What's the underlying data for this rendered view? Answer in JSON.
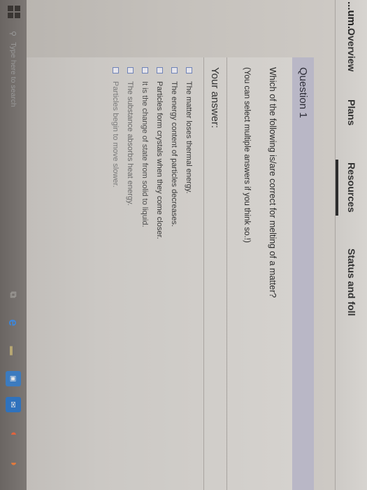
{
  "nav": {
    "partial_label": "...um...",
    "tabs": [
      {
        "label": "Overview"
      },
      {
        "label": "Plans"
      },
      {
        "label": "Resources"
      },
      {
        "label": "Status and foll"
      }
    ]
  },
  "question": {
    "header": "Question 1",
    "text": "Which of the following is/are correct for melting of a matter?",
    "hint": "(You can select multiple answers if you think so.!)"
  },
  "answer": {
    "title": "Your answer:",
    "options": [
      {
        "label": "The matter loses thermal energy."
      },
      {
        "label": "The energy content of particles decreases."
      },
      {
        "label": "Particles form crystals when they come closer."
      },
      {
        "label": "It is the change of state from solid to liquid."
      },
      {
        "label": "The substance absorbs heat energy."
      },
      {
        "label": "Particles begin to move slower."
      }
    ]
  },
  "taskbar": {
    "search_placeholder": "Type here to search",
    "icons": [
      "windows-start-icon",
      "search-icon",
      "task-view-icon",
      "edge-icon",
      "file-explorer-icon",
      "store-icon",
      "mail-icon",
      "app-icon"
    ]
  },
  "colors": {
    "question_header_bg": "#b9b7c6",
    "checkbox_border": "#6f83b8",
    "active_tab_underline": "#2c2c2c"
  }
}
